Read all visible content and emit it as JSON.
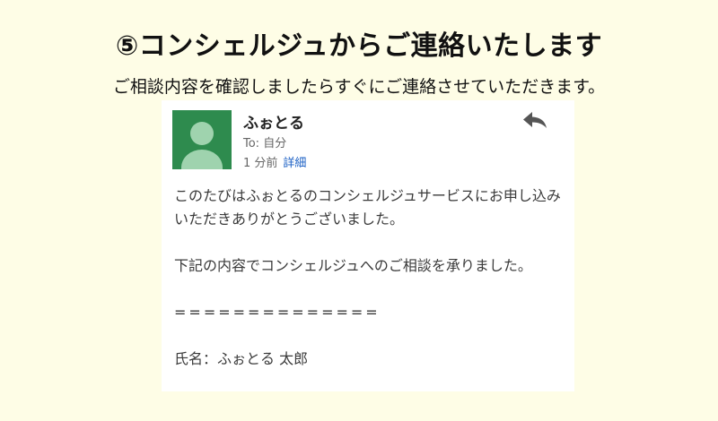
{
  "headline": "⑤コンシェルジュからご連絡いたします",
  "subline": "ご相談内容を確認しましたらすぐにご連絡させていただきます。",
  "email": {
    "sender": "ふぉとる",
    "to": "To: 自分",
    "time": "1 分前",
    "detail_link": "詳細",
    "body": {
      "paragraph1": "このたびはふぉとるのコンシェルジュサービスにお申し込みいただきありがとうございました。",
      "paragraph2": "下記の内容でコンシェルジュへのご相談を承りました。",
      "separator": "==============",
      "name_line": "氏名：ふぉとる 太郎"
    }
  },
  "colors": {
    "background": "#fefde6",
    "avatar": "#2e8b4e",
    "link": "#1a5fc4"
  },
  "icons": {
    "reply": "reply-arrow-icon",
    "avatar": "default-person-avatar"
  }
}
